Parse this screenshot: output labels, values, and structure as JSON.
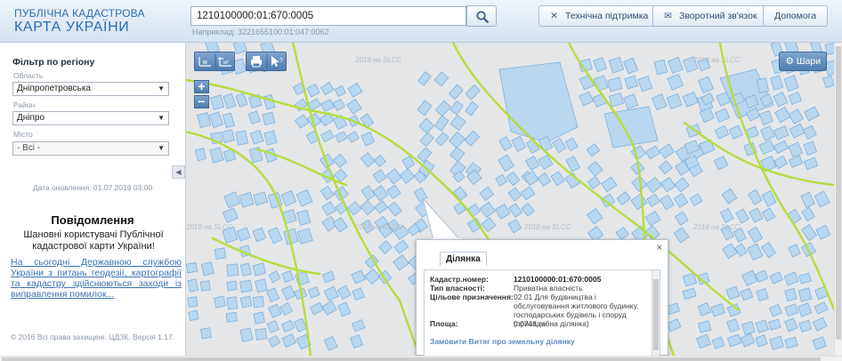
{
  "header": {
    "logo_line1": "ПУБЛІЧНА КАДАСТРОВА",
    "logo_line2": "КАРТА УКРАЇНИ",
    "search_value": "1210100000:01:670:0005",
    "search_hint": "Наприклад: 3221655100:01:047:0062",
    "support_label": "Технічна підтримка",
    "feedback_label": "Зворотний зв'язок",
    "help_label": "Допомога"
  },
  "filter": {
    "title": "Фільтр по регіону",
    "region_label": "Область",
    "region_value": "Дніпропетровська",
    "district_label": "Район",
    "district_value": "Дніпро",
    "city_label": "Місто",
    "city_value": "- Всі -"
  },
  "sidebar": {
    "update_date": "Дата оновлення: 01.07.2019 03:00",
    "notice_title": "Повідомлення",
    "notice_body": "Шановні користувачі Публічної кадастрової карти України!",
    "notice_link": "На сьогодні Державною службою України з питань геодезії, картографії та кадастру здійснюються заходи із виправлення помилок...",
    "copyright": "© 2016 Всі права захищені. ЦДЗК. Версія 1.17."
  },
  "map": {
    "layers_label": "Шари",
    "zoom_in_label": "+",
    "zoom_out_label": "−",
    "watermark": "2018 на SLCC",
    "tools": [
      "ruler-icon",
      "area-ruler-icon",
      "print-icon",
      "identify-icon"
    ]
  },
  "popup": {
    "tab_label": "Ділянка",
    "close_label": "×",
    "rows": [
      {
        "key": "Кадастр.номер:",
        "value": "1210100000:01:670:0005"
      },
      {
        "key": "Тип власності:",
        "value": "Приватна власність"
      },
      {
        "key": "Цільове призначення:",
        "value": "02.01 Для будівництва і обслуговування житлового будинку, господарських будівель і споруд (присадибна ділянка)"
      },
      {
        "key": "Площа:",
        "value": "0.0748 га"
      }
    ],
    "order_link": "Замовити Витяг про земельну ділянку"
  },
  "colors": {
    "brand": "#2a6db3",
    "parcel_fill": "#b9d8f0",
    "parcel_stroke": "#7fb1dc",
    "road": "#b6de3c",
    "map_bg": "#e4e6e8"
  }
}
